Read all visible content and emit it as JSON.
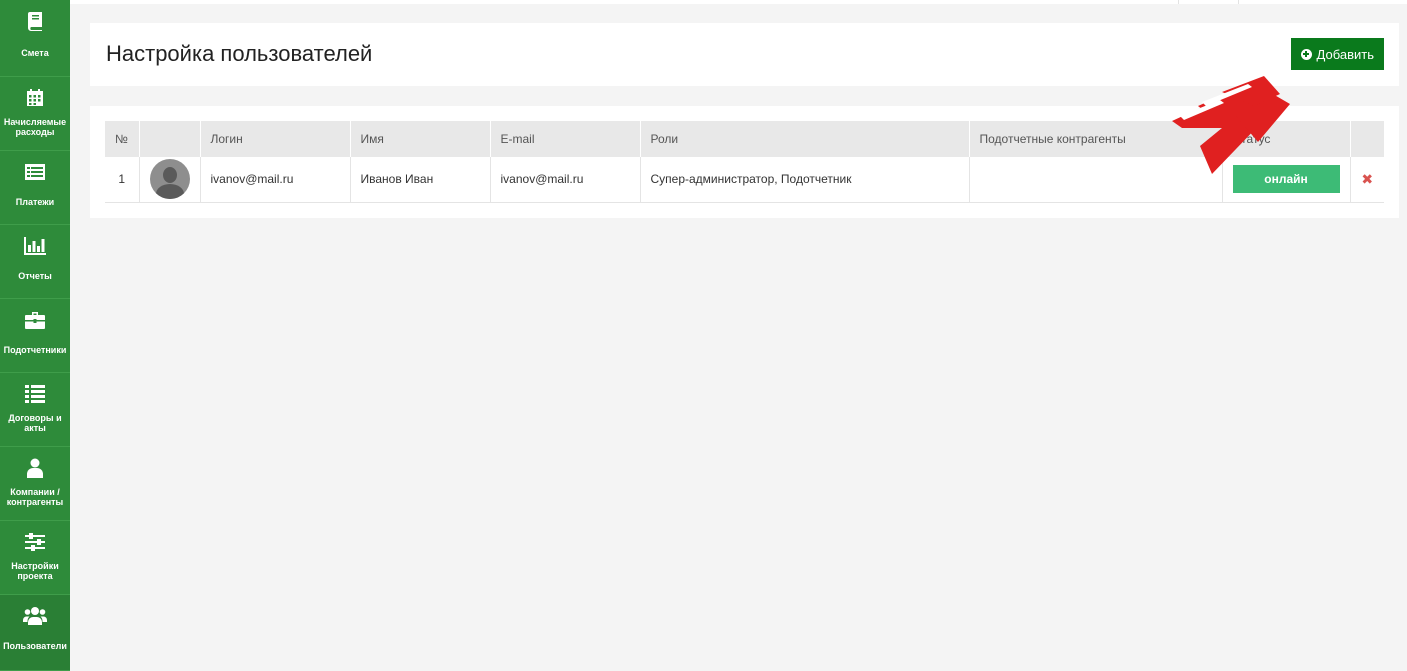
{
  "sidebar": {
    "items": [
      {
        "label": "Смета",
        "icon": "book-icon"
      },
      {
        "label": "Начисляемые расходы",
        "icon": "calendar-icon"
      },
      {
        "label": "Платежи",
        "icon": "list-card-icon"
      },
      {
        "label": "Отчеты",
        "icon": "bar-chart-icon"
      },
      {
        "label": "Подотчетники",
        "icon": "briefcase-icon"
      },
      {
        "label": "Договоры и акты",
        "icon": "list-icon"
      },
      {
        "label": "Компании / контрагенты",
        "icon": "user-icon"
      },
      {
        "label": "Настройки проекта",
        "icon": "sliders-icon"
      },
      {
        "label": "Пользователи",
        "icon": "users-icon"
      }
    ]
  },
  "header": {
    "title": "Настройка пользователей",
    "add_label": "Добавить"
  },
  "table": {
    "columns": [
      "№",
      "",
      "Логин",
      "Имя",
      "E-mail",
      "Роли",
      "Подотчетные контрагенты",
      "Статус",
      ""
    ],
    "rows": [
      {
        "num": "1",
        "login": "ivanov@mail.ru",
        "name": "Иванов Иван",
        "email": "ivanov@mail.ru",
        "roles": "Супер-администратор, Подотчетник",
        "contractors": "",
        "status": "онлайн"
      }
    ]
  },
  "colors": {
    "sidebar": "#2e8b3a",
    "add_button": "#0a7a1c",
    "status_online": "#3dbb76",
    "delete": "#d9534f",
    "annotation_arrow": "#e02020"
  }
}
